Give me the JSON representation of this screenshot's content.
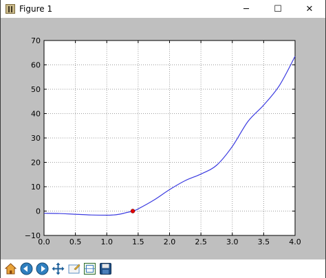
{
  "window": {
    "title": "Figure 1",
    "controls": {
      "minimize": "─",
      "maximize": "☐",
      "close": "✕"
    }
  },
  "toolbar": {
    "buttons": [
      {
        "name": "home-button",
        "icon": "home-icon"
      },
      {
        "name": "back-button",
        "icon": "back-arrow-icon"
      },
      {
        "name": "forward-button",
        "icon": "forward-arrow-icon"
      },
      {
        "name": "pan-button",
        "icon": "pan-icon"
      },
      {
        "name": "zoom-button",
        "icon": "zoom-rect-icon"
      },
      {
        "name": "configure-subplots-button",
        "icon": "subplots-icon"
      },
      {
        "name": "save-button",
        "icon": "floppy-disk-icon"
      }
    ]
  },
  "colors": {
    "figure_bg": "#bfbfbf",
    "line": "#3a3ae0",
    "marker": "#e00000"
  },
  "chart_data": {
    "type": "line",
    "title": "",
    "xlabel": "",
    "ylabel": "",
    "xlim": [
      0.0,
      4.0
    ],
    "ylim": [
      -10,
      70
    ],
    "grid": true,
    "xticks": [
      "0.0",
      "0.5",
      "1.0",
      "1.5",
      "2.0",
      "2.5",
      "3.0",
      "3.5",
      "4.0"
    ],
    "yticks": [
      "−10",
      "0",
      "10",
      "20",
      "30",
      "40",
      "50",
      "60",
      "70"
    ],
    "series": [
      {
        "x": [
          0.0,
          0.25,
          0.5,
          0.75,
          1.0,
          1.1,
          1.2,
          1.3,
          1.414,
          1.5,
          1.75,
          2.0,
          2.25,
          2.5,
          2.75,
          3.0,
          3.25,
          3.5,
          3.75,
          4.0
        ],
        "y": [
          -0.9,
          -1.0,
          -1.3,
          -1.6,
          -1.7,
          -1.6,
          -1.3,
          -0.7,
          0.0,
          0.9,
          4.5,
          8.8,
          12.5,
          15.2,
          18.8,
          26.5,
          36.8,
          43.5,
          51.5,
          63.5
        ]
      }
    ],
    "points": [
      {
        "x": 1.414,
        "y": 0.0
      }
    ]
  }
}
